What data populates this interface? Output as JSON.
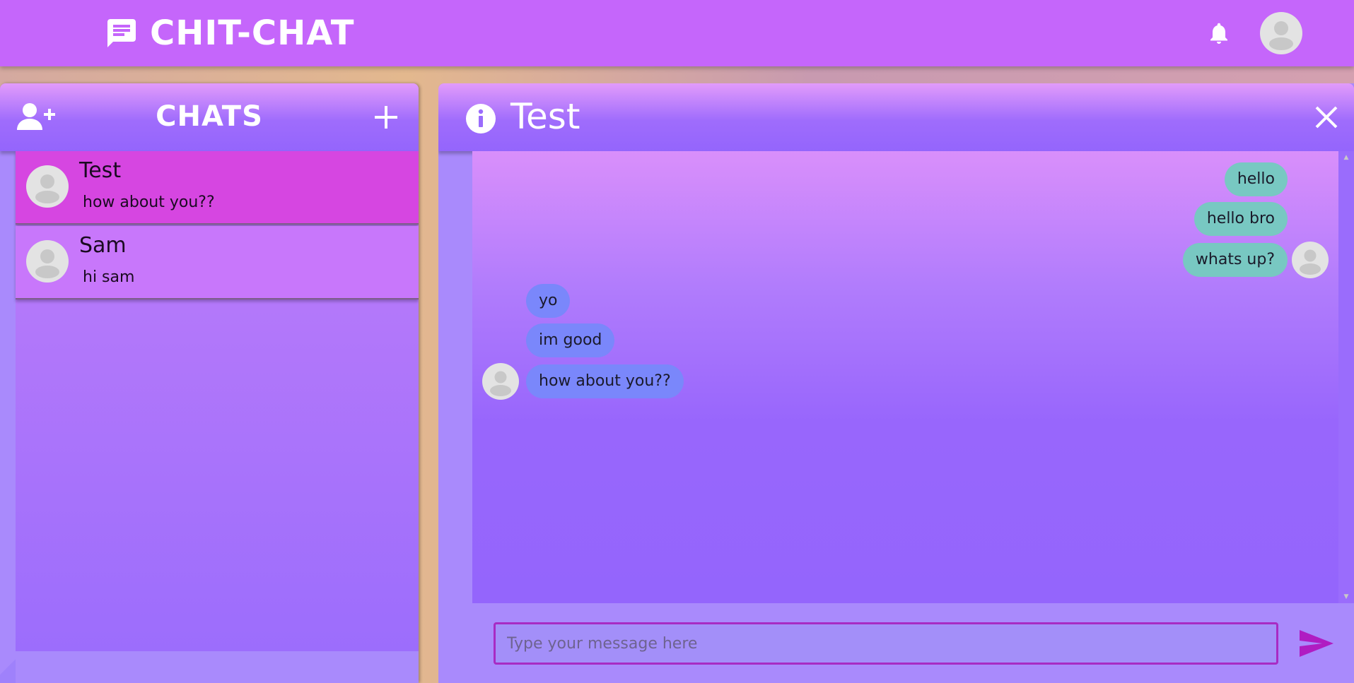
{
  "app": {
    "title": "CHIT-CHAT",
    "logo_icon": "chat-bubble-icon",
    "notification_icon": "bell-icon",
    "profile_icon": "user-avatar-icon"
  },
  "sidebar": {
    "title": "CHATS",
    "add_user_icon": "add-user-icon",
    "new_chat_icon": "plus-icon",
    "chats": [
      {
        "name": "Test",
        "preview": "how about you??",
        "active": true
      },
      {
        "name": "Sam",
        "preview": "hi sam",
        "active": false
      }
    ]
  },
  "conversation": {
    "title": "Test",
    "info_icon": "info-icon",
    "close_icon": "close-icon",
    "messages": [
      {
        "text": "hello",
        "direction": "sent"
      },
      {
        "text": "hello bro",
        "direction": "sent"
      },
      {
        "text": "whats up?",
        "direction": "sent",
        "show_avatar": true
      },
      {
        "text": "yo",
        "direction": "received"
      },
      {
        "text": "im good",
        "direction": "received"
      },
      {
        "text": "how about you??",
        "direction": "received",
        "show_avatar": true
      }
    ],
    "composer": {
      "placeholder": "Type your message here",
      "value": "",
      "send_icon": "send-icon"
    }
  },
  "colors": {
    "header": "#c566fb",
    "active_chat": "#d646e1",
    "chat_item": "#c877fb",
    "sent_bubble": "#78c8c2",
    "received_bubble": "#7a87fb",
    "accent": "#a82bc4"
  }
}
